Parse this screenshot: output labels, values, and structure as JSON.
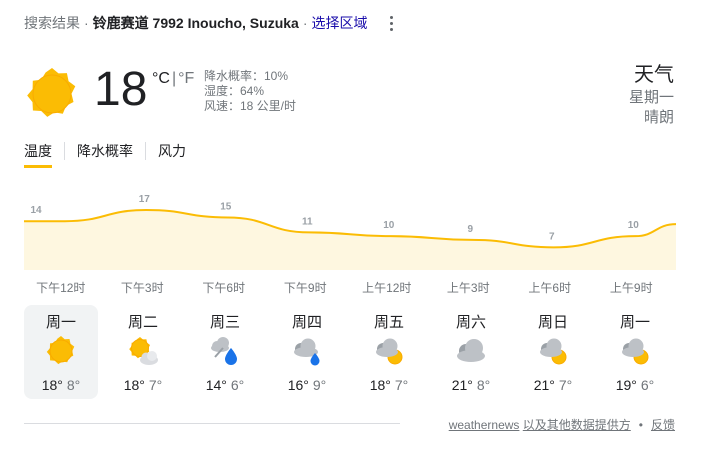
{
  "header": {
    "prefix": "搜索结果",
    "location": "铃鹿赛道 7992 Inoucho, Suzuka",
    "region_link": "选择区域"
  },
  "current": {
    "icon": "sunny-icon",
    "temperature": "18",
    "unit_c": "°C",
    "unit_f": "°F",
    "precip": "降水概率：10%",
    "humidity": "湿度：64%",
    "wind": "风速：18 公里/时"
  },
  "summary": {
    "title": "天气",
    "day": "星期一",
    "condition": "晴朗"
  },
  "tabs": [
    "温度",
    "降水概率",
    "风力"
  ],
  "chart_data": {
    "type": "area",
    "x": [
      "下午12时",
      "下午3时",
      "下午6时",
      "下午9时",
      "上午12时",
      "上午3时",
      "上午6时",
      "上午9时"
    ],
    "values": [
      14,
      17,
      15,
      11,
      10,
      9,
      7,
      10
    ],
    "labels": [
      "14",
      "17",
      "15",
      "11",
      "10",
      "9",
      "7",
      "10"
    ],
    "ylim": [
      0,
      20
    ],
    "color": "#fbbc04",
    "fill": "#fef7e0"
  },
  "days": [
    {
      "name": "周一",
      "icon": "sunny-icon",
      "hi": "18°",
      "lo": "8°"
    },
    {
      "name": "周二",
      "icon": "partly-cloudy-icon",
      "hi": "18°",
      "lo": "7°"
    },
    {
      "name": "周三",
      "icon": "rain-icon",
      "hi": "14°",
      "lo": "6°"
    },
    {
      "name": "周四",
      "icon": "showers-icon",
      "hi": "16°",
      "lo": "9°"
    },
    {
      "name": "周五",
      "icon": "mostly-cloudy-icon",
      "hi": "18°",
      "lo": "7°"
    },
    {
      "name": "周六",
      "icon": "cloudy-icon",
      "hi": "21°",
      "lo": "8°"
    },
    {
      "name": "周日",
      "icon": "mostly-cloudy-icon",
      "hi": "21°",
      "lo": "7°"
    },
    {
      "name": "周一",
      "icon": "mostly-cloudy-icon",
      "hi": "19°",
      "lo": "6°"
    }
  ],
  "footer": {
    "source": "weathernews",
    "others": "以及其他数据提供方",
    "dot": "•",
    "feedback": "反馈"
  },
  "colors": {
    "sun": "#fbbc04",
    "cloud": "#c8c8c8",
    "rain": "#1a73e8",
    "link": "#1a0dab"
  }
}
